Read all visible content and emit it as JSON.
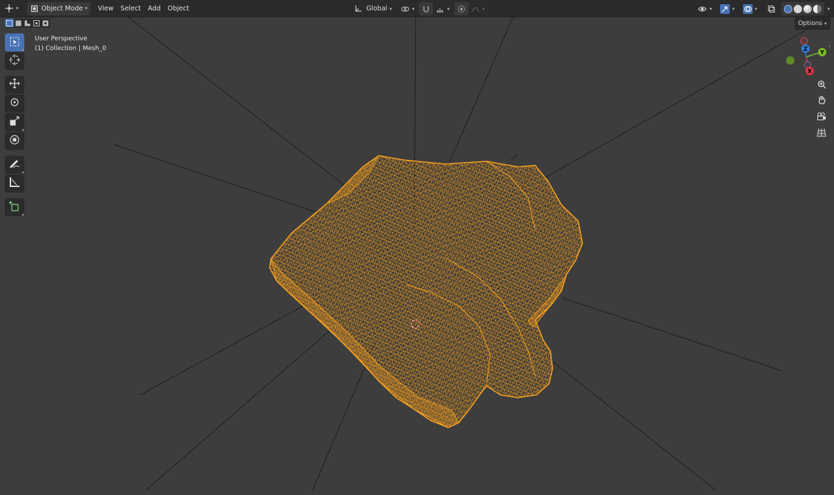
{
  "header": {
    "editor_type_icon": "viewport-editor-icon",
    "mode_label": "Object Mode",
    "menus": [
      "View",
      "Select",
      "Add",
      "Object"
    ],
    "transform_orientation": "Global",
    "right_icons": [
      "visibility-icon",
      "gizmo-icon",
      "overlay-icon",
      "xray-icon"
    ]
  },
  "select_modes": [
    "select-new-icon",
    "select-extend-icon",
    "select-subtract-icon",
    "select-intersect-icon",
    "select-invert-icon"
  ],
  "toolbar": {
    "tools": [
      "select-box-icon",
      "cursor-icon",
      "move-icon",
      "rotate-icon",
      "scale-icon",
      "transform-icon",
      "annotate-icon",
      "measure-icon",
      "add-cube-icon"
    ],
    "active_tool": "select-box-icon"
  },
  "viewport_info": {
    "view_name": "User Perspective",
    "collection_line": "(1) Collection | Mesh_0"
  },
  "options_label": "Options",
  "gizmo": {
    "axes": [
      {
        "label": "Z",
        "color": "#2e7cd6"
      },
      {
        "label": "Y",
        "color": "#7cb92a"
      },
      {
        "label": "X",
        "color": "#e0344a"
      }
    ]
  },
  "nav_buttons": [
    "zoom-icon",
    "pan-hand-icon",
    "camera-icon",
    "ortho-grid-icon"
  ],
  "colors": {
    "viewport_bg": "#3d3d3d",
    "header_bg": "#2b2b2b",
    "active_blue": "#4772b3",
    "selection_orange": "#f5a020"
  }
}
